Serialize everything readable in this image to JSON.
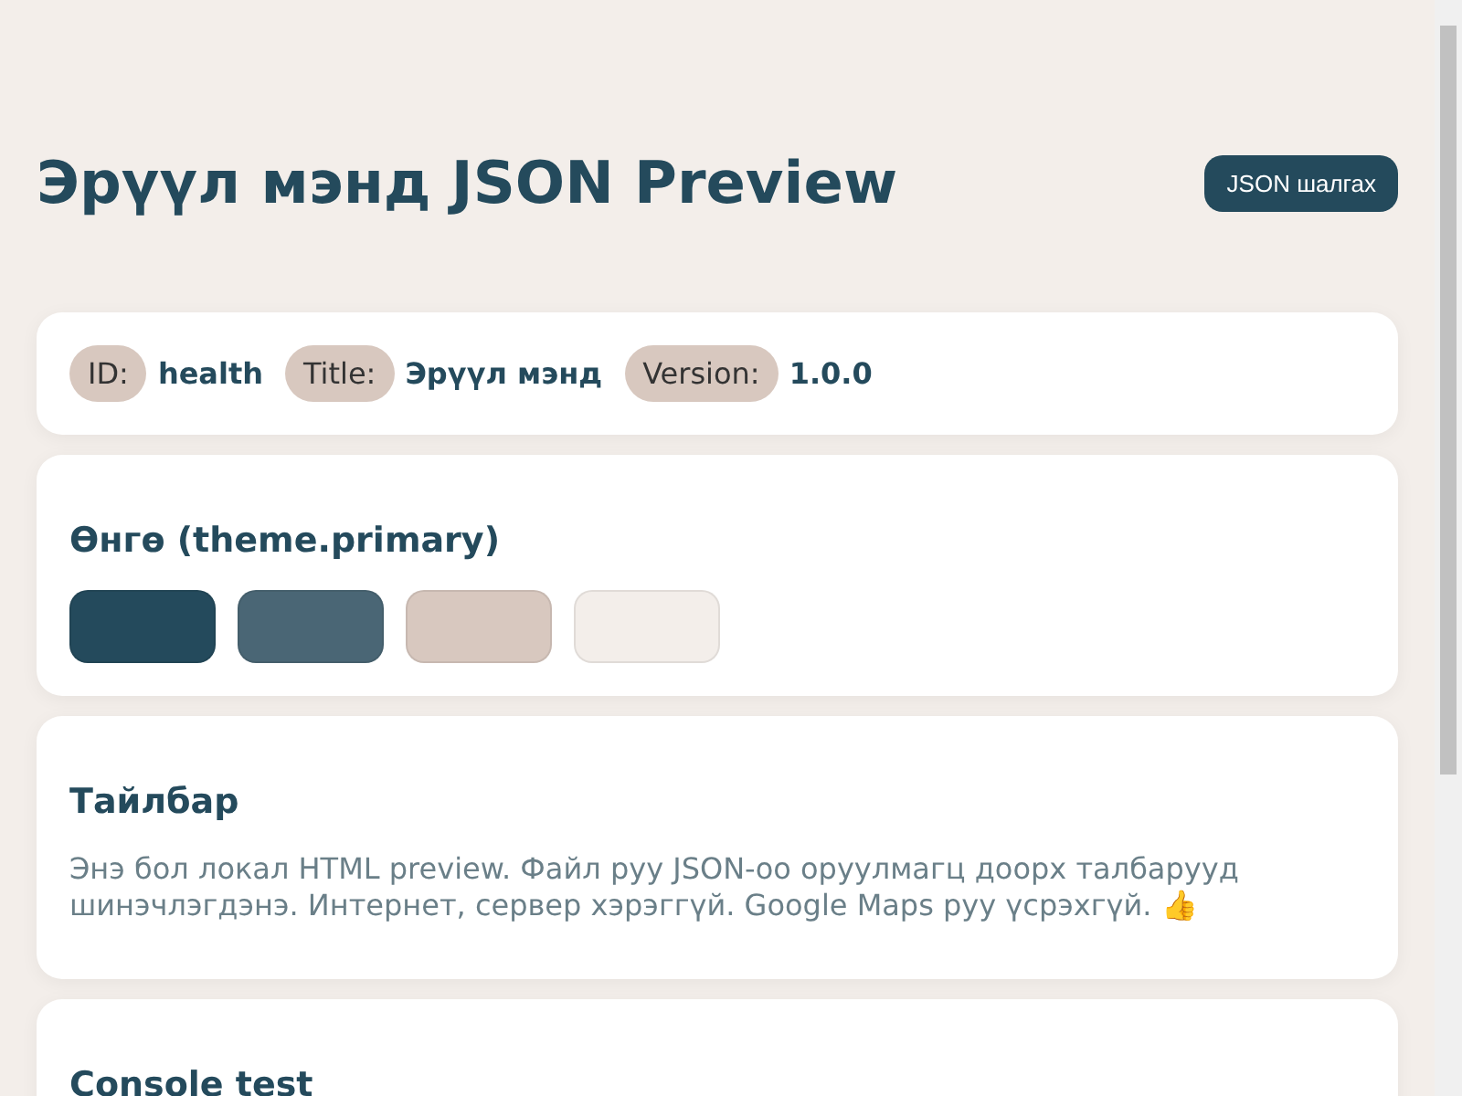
{
  "header": {
    "title": "Эрүүл мэнд JSON Preview",
    "button": "JSON шалгах"
  },
  "meta": [
    {
      "label": "ID:",
      "value": "health"
    },
    {
      "label": "Title:",
      "value": "Эрүүл мэнд"
    },
    {
      "label": "Version:",
      "value": "1.0.0"
    }
  ],
  "colors": {
    "heading": "Өнгө (theme.primary)",
    "swatches": [
      {
        "color": "#244a5c"
      },
      {
        "color": "#4a6675"
      },
      {
        "color": "#d8c8bf"
      },
      {
        "color": "#f3eeea"
      }
    ]
  },
  "description": {
    "heading": "Тайлбар",
    "text": "Энэ бол локал HTML preview. Файл руу JSON-оо оруулмагц доорх талбарууд шинэчлэгдэнэ. Интернет, сервер хэрэггүй. Google Maps руу үсрэхгүй. 👍"
  },
  "console": {
    "heading": "Console test"
  }
}
